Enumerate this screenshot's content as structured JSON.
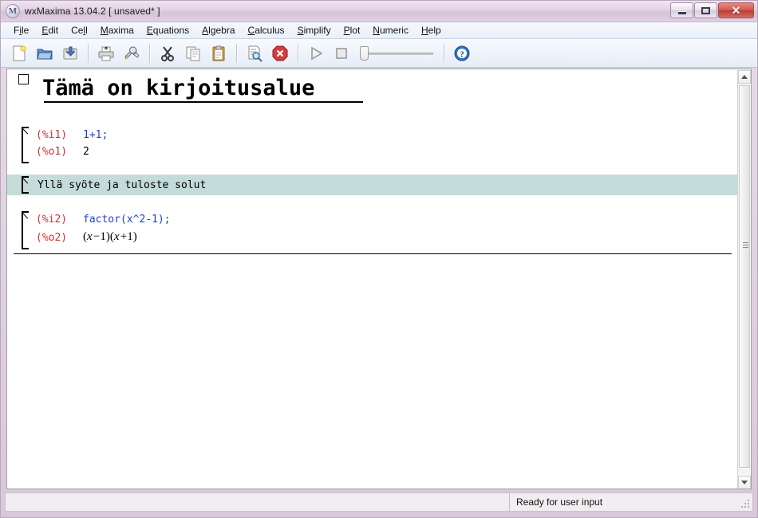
{
  "window": {
    "app_icon": "maxima-logo-icon",
    "title": "wxMaxima 13.04.2 [ unsaved* ]",
    "buttons": {
      "minimize": "minimize-icon",
      "maximize": "maximize-icon",
      "close": "✕"
    }
  },
  "menubar": {
    "items": [
      {
        "label": "File",
        "pre": "F",
        "acc": "i",
        "post": "le"
      },
      {
        "label": "Edit",
        "pre": "",
        "acc": "E",
        "post": "dit"
      },
      {
        "label": "Cell",
        "pre": "Ce",
        "acc": "l",
        "post": "l"
      },
      {
        "label": "Maxima",
        "pre": "",
        "acc": "M",
        "post": "axima"
      },
      {
        "label": "Equations",
        "pre": "",
        "acc": "E",
        "post": "quations"
      },
      {
        "label": "Algebra",
        "pre": "",
        "acc": "A",
        "post": "lgebra"
      },
      {
        "label": "Calculus",
        "pre": "",
        "acc": "C",
        "post": "alculus"
      },
      {
        "label": "Simplify",
        "pre": "",
        "acc": "S",
        "post": "implify"
      },
      {
        "label": "Plot",
        "pre": "",
        "acc": "P",
        "post": "lot"
      },
      {
        "label": "Numeric",
        "pre": "",
        "acc": "N",
        "post": "umeric"
      },
      {
        "label": "Help",
        "pre": "",
        "acc": "H",
        "post": "elp"
      }
    ]
  },
  "toolbar": {
    "buttons": [
      "new-document-icon",
      "open-folder-icon",
      "save-icon",
      "print-icon",
      "preferences-icon",
      "cut-icon",
      "copy-icon",
      "paste-icon",
      "find-icon",
      "interrupt-icon",
      "evaluate-icon",
      "stop-icon",
      "help-icon"
    ],
    "slider": {
      "name": "animation-slider",
      "value": 0
    }
  },
  "worksheet": {
    "heading": {
      "text": "Tämä on kirjoitusalue",
      "marker": "section-collapse-box"
    },
    "cells": [
      {
        "type": "code",
        "input_label": "(%i1)",
        "input_code": "1+1;",
        "output_label": "(%o1)",
        "output_text": "2"
      },
      {
        "type": "text",
        "selected": true,
        "text": "Yllä syöte ja tuloste solut"
      },
      {
        "type": "code",
        "input_label": "(%i2)",
        "input_code": "factor(x^2-1);",
        "output_label": "(%o2)",
        "output_math": "(x −1)(x +1)"
      }
    ]
  },
  "scrollbar": {
    "up": "scroll-up-arrow-icon",
    "down": "scroll-down-arrow-icon",
    "thumb": "vertical-scroll-thumb"
  },
  "statusbar": {
    "left_text": "",
    "right_text": "Ready for user input"
  },
  "colors": {
    "input_label": "#cf3333",
    "input_code": "#1f3fcf",
    "selection": "#c4dcd9",
    "titlebar": "#e3d2e4",
    "close_button": "#c8504a"
  }
}
